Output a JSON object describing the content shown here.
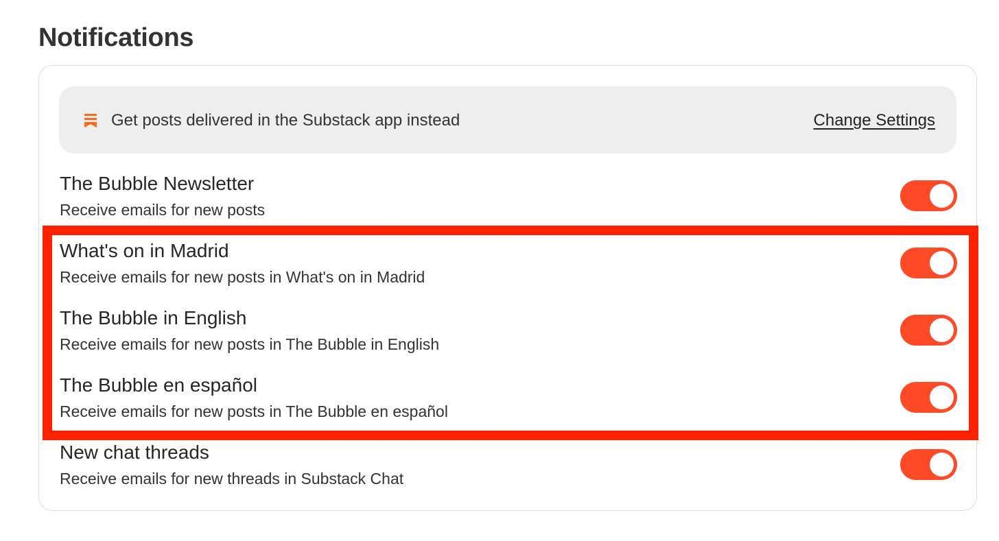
{
  "page": {
    "title": "Notifications"
  },
  "banner": {
    "icon": "substack-bookmark-icon",
    "icon_color": "#ff6719",
    "text": "Get posts delivered in the Substack app instead",
    "link_label": "Change Settings"
  },
  "rows": [
    {
      "title": "The Bubble Newsletter",
      "description": "Receive emails for new posts",
      "enabled": true
    },
    {
      "title": "What's on in Madrid",
      "description": "Receive emails for new posts in What's on in Madrid",
      "enabled": true
    },
    {
      "title": "The Bubble in English",
      "description": "Receive emails for new posts in The Bubble in English",
      "enabled": true
    },
    {
      "title": "The Bubble en español",
      "description": "Receive emails for new posts in The Bubble en español",
      "enabled": true
    },
    {
      "title": "New chat threads",
      "description": "Receive emails for new threads in Substack Chat",
      "enabled": true
    }
  ],
  "colors": {
    "toggle_on": "#ff4a27",
    "highlight": "#ff2200",
    "banner_bg": "#eeeeee"
  }
}
